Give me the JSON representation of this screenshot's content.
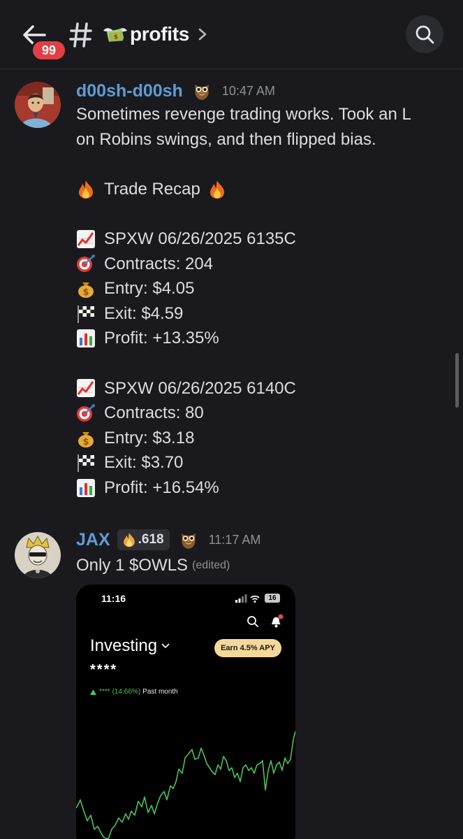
{
  "header": {
    "unread_count": "99",
    "channel_name": "profits"
  },
  "messages": [
    {
      "username": "d00sh-d00sh",
      "timestamp": "10:47 AM",
      "lines": [
        "Sometimes revenge trading works. Took an L",
        "on Robins swings, and then flipped bias.",
        "",
        "Trade Recap",
        "",
        "SPXW 06/26/2025 6135C",
        "Contracts: 204",
        "Entry: $4.05",
        "Exit: $4.59",
        "Profit: +13.35%",
        "",
        "SPXW 06/26/2025 6140C",
        "Contracts: 80",
        "Entry: $3.18",
        "Exit: $3.70",
        "Profit: +16.54%"
      ]
    },
    {
      "username": "JAX",
      "tag": ".618",
      "timestamp": "11:17 AM",
      "text": "Only 1 $OWLS",
      "edited_label": "(edited)",
      "attachment": {
        "phone_time": "11:16",
        "battery": "16",
        "title": "Investing",
        "earn_button": "Earn 4.5% APY",
        "masked_value": "****",
        "change_masked": "****",
        "change_percent": "(14.66%)",
        "change_period": "Past month"
      }
    }
  ],
  "icons": {
    "back": "arrow-left-icon",
    "hash": "hash-icon",
    "search": "search-icon",
    "badge": "owl-icon",
    "fire": "fire-icon",
    "chart_up": "chart-increasing-icon",
    "target": "target-icon",
    "money": "money-bag-icon",
    "flag": "checkered-flag-icon",
    "bar": "bar-chart-icon"
  },
  "colors": {
    "background": "#1a1a1e",
    "username": "#5d9cd6",
    "badge": "#e23f45",
    "chart_line": "#4cc35a"
  }
}
